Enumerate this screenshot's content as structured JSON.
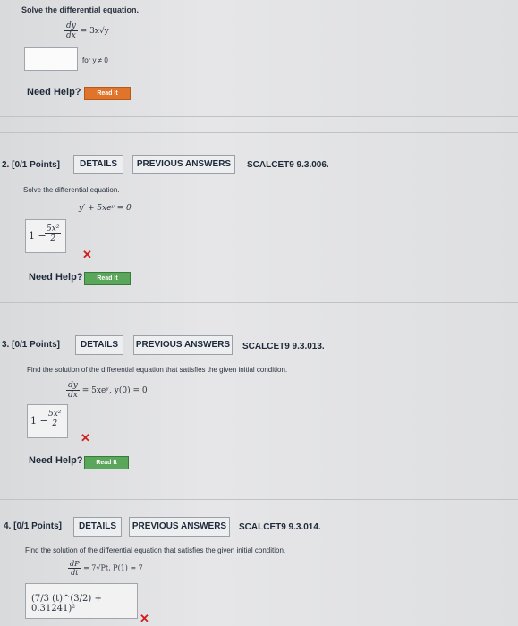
{
  "q1": {
    "prompt": "Solve the differential equation.",
    "eq_lhs_num": "dy",
    "eq_lhs_den": "dx",
    "eq_rhs": "= 3x√y",
    "condition": "for y ≠ 0",
    "answer_value": "",
    "need_help": "Need Help?",
    "read_it": "Read It"
  },
  "q2": {
    "header": "2. [0/1 Points]",
    "details": "DETAILS",
    "previous_answers": "PREVIOUS ANSWERS",
    "code": "SCALCET9 9.3.006.",
    "prompt": "Solve the differential equation.",
    "equation": "y′ + 5xeʸ = 0",
    "answer_prefix": "1 −",
    "answer_num": "5x²",
    "answer_den": "2",
    "need_help": "Need Help?",
    "read_it": "Read It"
  },
  "q3": {
    "header": "3. [0/1 Points]",
    "details": "DETAILS",
    "previous_answers": "PREVIOUS ANSWERS",
    "code": "SCALCET9 9.3.013.",
    "prompt": "Find the solution of the differential equation that satisfies the given initial condition.",
    "eq_lhs_num": "dy",
    "eq_lhs_den": "dx",
    "eq_rhs": "= 5xeʸ,   y(0) = 0",
    "answer_prefix": "1 −",
    "answer_num": "5x²",
    "answer_den": "2",
    "need_help": "Need Help?",
    "read_it": "Read It"
  },
  "q4": {
    "header": "4. [0/1 Points]",
    "details": "DETAILS",
    "previous_answers": "PREVIOUS ANSWERS",
    "code": "SCALCET9 9.3.014.",
    "prompt": "Find the solution of the differential equation that satisfies the given initial condition.",
    "eq_lhs_num": "dP",
    "eq_lhs_den": "dt",
    "eq_rhs": "= 7√Pt,  P(1) = 7",
    "answer_expr": "(7/3 (t)^(3/2) + 0.31241)²"
  },
  "colors": {
    "wrong": "#d11d1d",
    "read_it": "#e0742a"
  }
}
